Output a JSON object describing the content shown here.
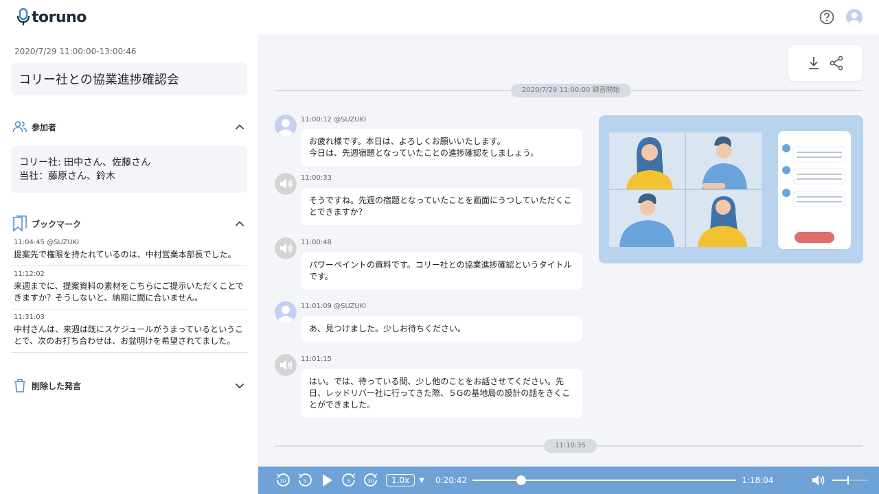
{
  "app": {
    "logo_text": "toruno"
  },
  "meeting": {
    "date_time": "2020/7/29  11:00:00-13:00:46",
    "title": "コリー社との協業進捗確認会"
  },
  "participants": {
    "label": "参加者",
    "lines": [
      "コリー社: 田中さん、佐藤さん",
      "当社：藤原さん、鈴木"
    ]
  },
  "bookmarks": {
    "label": "ブックマーク",
    "items": [
      {
        "time": "11:04:45 @SUZUKI",
        "text": "提案先で権限を持たれているのは、中村営業本部長でした。"
      },
      {
        "time": "11:12:02",
        "text": "来週までに、提案資料の素材をこちらにご提示いただくことできますか？そうしないと、納期に間に合いません。"
      },
      {
        "time": "11:31:03",
        "text": "中村さんは、来週は既にスケジュールがうまっているということで、次のお打ち合わせは、お盆明けを希望されてました。"
      }
    ]
  },
  "deleted": {
    "label": "削除した発言"
  },
  "transcript": {
    "start_marker": "2020/7/29  11:00:00 録音開始",
    "end_marker": "11:10:35",
    "messages": [
      {
        "meta": "11:00:12 @SUZUKI",
        "avatar": "user",
        "text": "お疲れ様です。本日は、よろしくお願いいたします。\n今日は、先週宿題となっていたことの進捗確認をしましょう。"
      },
      {
        "meta": "11:00:33",
        "avatar": "speaker",
        "text": "そうですね。先週の宿題となっていたことを画面にうつしていただくことできますか？"
      },
      {
        "meta": "11:00:48",
        "avatar": "speaker",
        "text": "パワーペイントの資料です。コリー社との協業進捗確認というタイトルです。"
      },
      {
        "meta": "11:01:09 @SUZUKI",
        "avatar": "user",
        "text": "あ、見つけました。少しお待ちください。"
      },
      {
        "meta": "11:01:15",
        "avatar": "speaker",
        "text": "はい。では、待っている間、少し他のことをお話させてください。先日、レッドリバー社に行ってきた際、５Gの基地局の設計の話をきくことができました。"
      }
    ]
  },
  "player": {
    "speed": "1.0x",
    "current_time": "0:20:42",
    "total_time": "1:18:04",
    "progress": 0.185,
    "volume": 0.45
  },
  "colors": {
    "accent": "#6fa2d6",
    "avatar_user": "#c5cff5",
    "avatar_speaker": "#d4d4d4",
    "background": "#f4f5f9"
  }
}
